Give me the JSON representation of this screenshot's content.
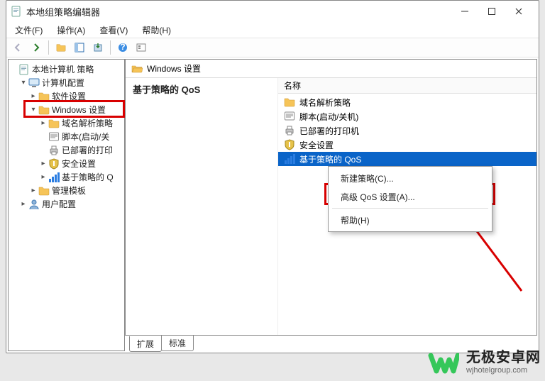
{
  "window": {
    "title": "本地组策略编辑器"
  },
  "menubar": {
    "file": "文件(F)",
    "action": "操作(A)",
    "view": "查看(V)",
    "help": "帮助(H)"
  },
  "tree": {
    "root": "本地计算机 策略",
    "computer_config": "计算机配置",
    "software_settings": "软件设置",
    "windows_settings": "Windows 设置",
    "dns_policy": "域名解析策略",
    "scripts": "脚本(启动/关",
    "deployed_printers": "已部署的打印",
    "security_settings": "安全设置",
    "qos": "基于策略的 Q",
    "admin_templates": "管理模板",
    "user_config": "用户配置"
  },
  "right": {
    "path_label": "Windows 设置",
    "desc_heading": "基于策略的 QoS",
    "col_name": "名称",
    "items": {
      "dns_policy": "域名解析策略",
      "scripts": "脚本(启动/关机)",
      "deployed_printers": "已部署的打印机",
      "security_settings": "安全设置",
      "qos": "基于策略的 QoS"
    }
  },
  "context_menu": {
    "new_policy": "新建策略(C)...",
    "advanced_qos": "高级 QoS 设置(A)...",
    "help": "帮助(H)"
  },
  "tabs": {
    "extended": "扩展",
    "standard": "标准"
  },
  "watermark": {
    "cn": "无极安卓网",
    "en": "wjhotelgroup.com"
  }
}
